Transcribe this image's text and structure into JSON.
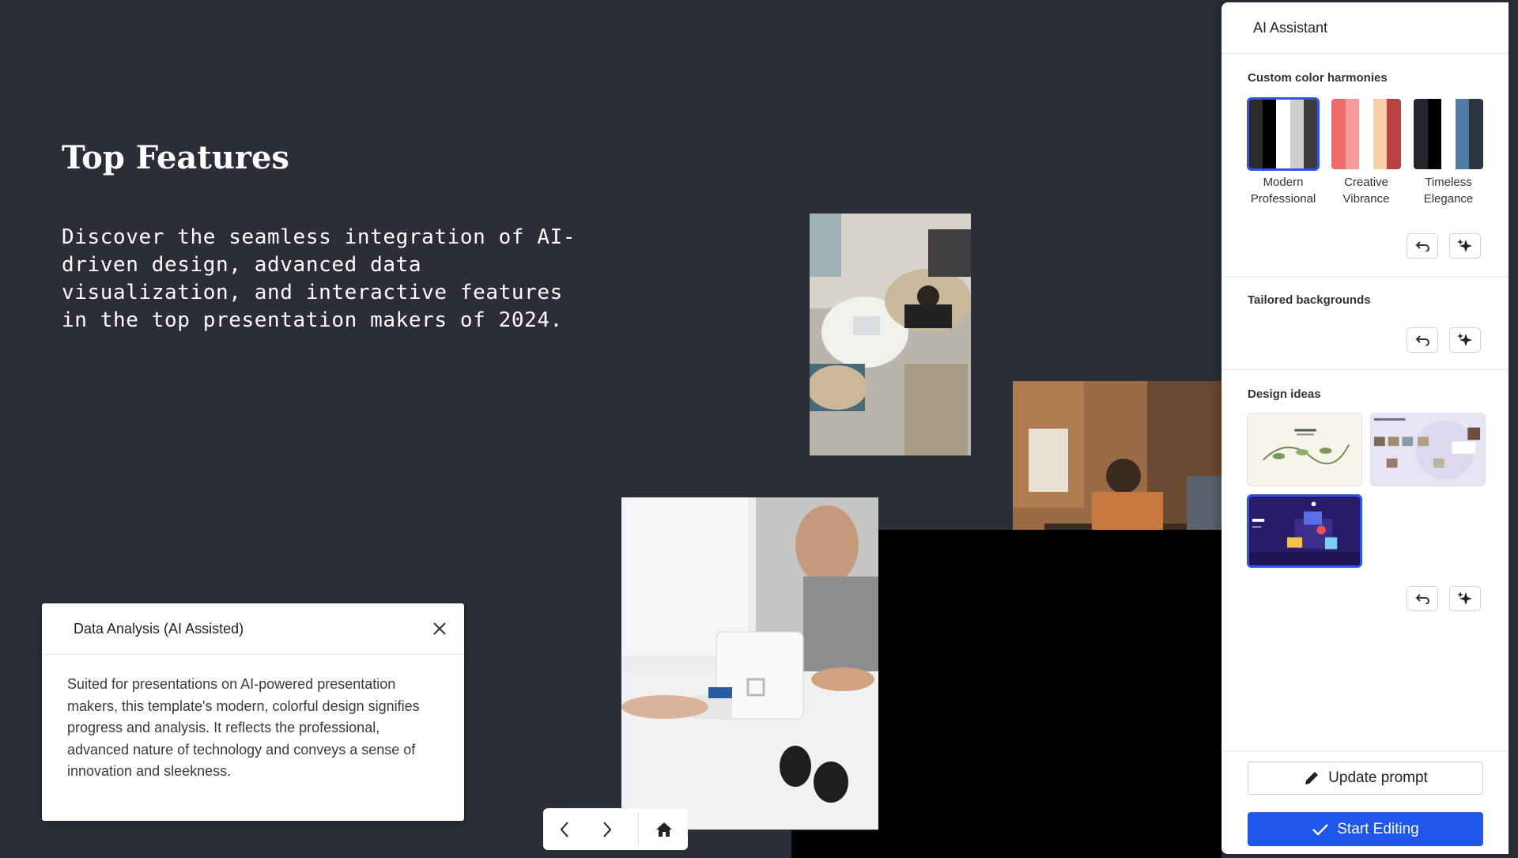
{
  "slide": {
    "title": "Top Features",
    "body": "Discover the seamless integration of AI-driven design, advanced data visualization, and interactive features in the top presentation makers of 2024."
  },
  "ai_panel": {
    "title": "AI Assistant",
    "color_harmonies": {
      "title": "Custom color harmonies",
      "items": [
        {
          "label_line1": "Modern",
          "label_line2": "Professional",
          "colors": [
            "#2a2a2e",
            "#000000",
            "#ffffff",
            "#cfcfcf",
            "#3a3a3f"
          ],
          "selected": true
        },
        {
          "label_line1": "Creative",
          "label_line2": "Vibrance",
          "colors": [
            "#ef6c6c",
            "#f49b9b",
            "#ffffff",
            "#f8d0a8",
            "#b64242"
          ],
          "selected": false
        },
        {
          "label_line1": "Timeless",
          "label_line2": "Elegance",
          "colors": [
            "#23262e",
            "#000000",
            "#ffffff",
            "#4e7ba8",
            "#2c3640"
          ],
          "selected": false
        }
      ]
    },
    "backgrounds": {
      "title": "Tailored backgrounds"
    },
    "design_ideas": {
      "title": "Design ideas"
    },
    "update_prompt_label": "Update prompt",
    "start_editing_label": "Start Editing",
    "accent_color": "#1f57e8"
  },
  "analysis_card": {
    "title": "Data Analysis (AI Assisted)",
    "body": "Suited for presentations on AI-powered presentation makers, this template's modern, colorful design signifies progress and analysis. It reflects the professional, advanced nature of technology and conveys a sense of innovation and sleekness."
  }
}
